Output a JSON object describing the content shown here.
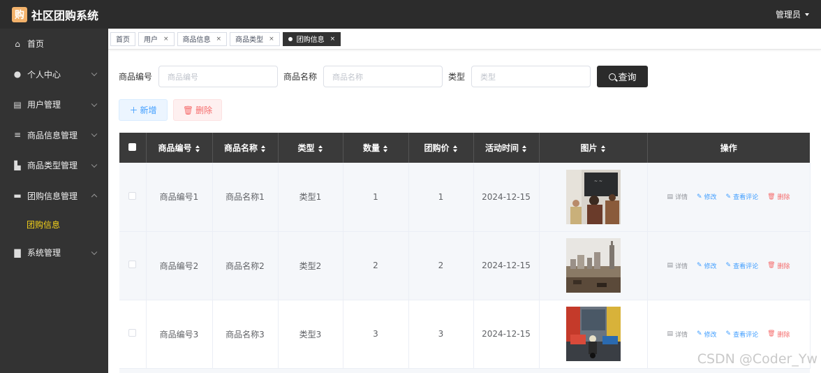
{
  "app": {
    "logo_char": "购",
    "title": "社区团购系统",
    "user_label": "管理员"
  },
  "sidebar": {
    "items": [
      {
        "label": "首页",
        "icon": "home-icon",
        "glyph": "⌂",
        "expandable": false
      },
      {
        "label": "个人中心",
        "icon": "user-icon",
        "glyph": "●",
        "expandable": true
      },
      {
        "label": "用户管理",
        "icon": "clipboard-icon",
        "glyph": "▤",
        "expandable": true
      },
      {
        "label": "商品信息管理",
        "icon": "list-icon",
        "glyph": "≡",
        "expandable": true
      },
      {
        "label": "商品类型管理",
        "icon": "bar-chart-icon",
        "glyph": "▙",
        "expandable": true
      },
      {
        "label": "团购信息管理",
        "icon": "message-icon",
        "glyph": "▬",
        "expandable": true,
        "expanded": true,
        "children": [
          {
            "label": "团购信息",
            "active": true
          }
        ]
      },
      {
        "label": "系统管理",
        "icon": "briefcase-icon",
        "glyph": "▇",
        "expandable": true
      }
    ]
  },
  "tabs": [
    {
      "label": "首页",
      "closable": false,
      "active": false
    },
    {
      "label": "用户",
      "closable": true,
      "active": false
    },
    {
      "label": "商品信息",
      "closable": true,
      "active": false
    },
    {
      "label": "商品类型",
      "closable": true,
      "active": false
    },
    {
      "label": "团购信息",
      "closable": true,
      "active": true
    }
  ],
  "search": {
    "fields": [
      {
        "label": "商品编号",
        "placeholder": "商品编号"
      },
      {
        "label": "商品名称",
        "placeholder": "商品名称"
      },
      {
        "label": "类型",
        "placeholder": "类型"
      }
    ],
    "button_label": "查询"
  },
  "actions": {
    "add_label": "新增",
    "delete_label": "删除"
  },
  "table": {
    "columns": [
      "商品编号",
      "商品名称",
      "类型",
      "数量",
      "团购价",
      "活动时间",
      "图片",
      "操作"
    ],
    "rows": [
      {
        "code": "商品编号1",
        "name": "商品名称1",
        "type": "类型1",
        "qty": "1",
        "price": "1",
        "date": "2024-12-15",
        "image": "classroom-photo"
      },
      {
        "code": "商品编号2",
        "name": "商品名称2",
        "type": "类型2",
        "qty": "2",
        "price": "2",
        "date": "2024-12-15",
        "image": "city-skyline-photo"
      },
      {
        "code": "商品编号3",
        "name": "商品名称3",
        "type": "类型3",
        "qty": "3",
        "price": "3",
        "date": "2024-12-15",
        "image": "street-traffic-photo"
      }
    ],
    "row_actions": {
      "detail": "详情",
      "edit": "修改",
      "view_comments": "查看评论",
      "delete": "删除"
    }
  },
  "watermark": "CSDN @Coder_Yw",
  "colors": {
    "header_bg": "#2c2c2c",
    "sidebar_bg": "#333333",
    "active_submenu": "#f5d21a",
    "primary": "#409eff",
    "danger": "#f56c6c",
    "logo": "#f3b26b"
  }
}
